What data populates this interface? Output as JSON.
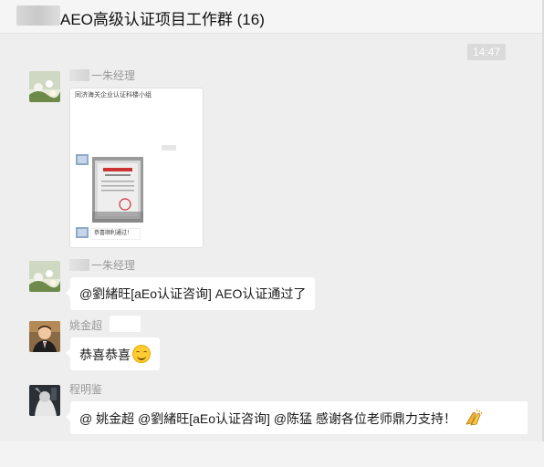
{
  "chat": {
    "title": "AEO高级认证项目工作群 (16)",
    "timestamp": "14:47"
  },
  "messages": [
    {
      "sender": "一朱经理",
      "image": {
        "header": "同济海关企业认证科楼小组",
        "caption": "恭喜顺利通过！"
      }
    },
    {
      "sender": "一朱经理",
      "text": "@劉緒旺[aEo认证咨询] AEO认证通过了"
    },
    {
      "sender": "姚金超",
      "text": "恭喜恭喜",
      "emoji": "smiley-icon"
    },
    {
      "sender": "程明鉴",
      "text": "@ 姚金超 @劉緒旺[aEo认证咨询] @陈猛 感谢各位老师鼎力支持！",
      "emoji": "clapping-hands-icon"
    }
  ],
  "colors": {
    "chat_background": "#eeeeee",
    "bubble": "#ffffff",
    "name_text": "#999999"
  }
}
